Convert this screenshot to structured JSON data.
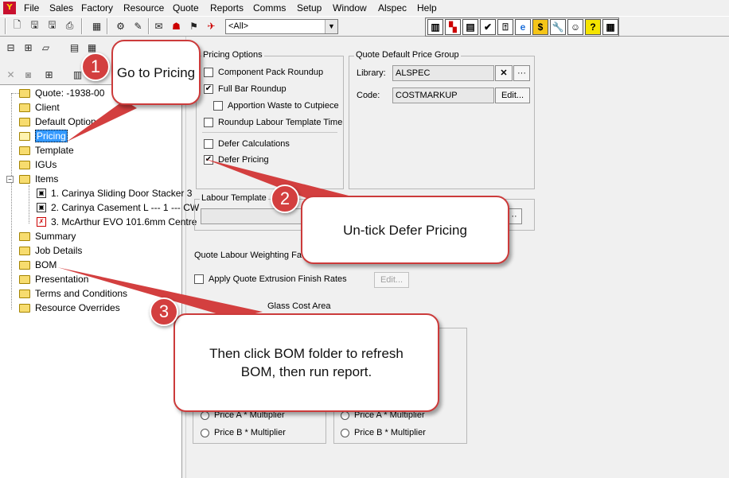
{
  "menu": [
    "File",
    "Sales",
    "Factory",
    "Resource",
    "Quote",
    "Reports",
    "Comms",
    "Setup",
    "Window",
    "Alspec",
    "Help"
  ],
  "app_icon": "Y",
  "toolbar": {
    "filter_value": "<All>"
  },
  "tree": {
    "root": "Quote: -1938-00",
    "items": [
      "Client",
      "Default Options",
      "Pricing",
      "Template",
      "IGUs",
      "Items"
    ],
    "children": [
      "1. Carinya Sliding Door Stacker 3",
      "2. Carinya Casement L --- 1 --- CW",
      "3. McArthur EVO 101.6mm Centre"
    ],
    "after": [
      "Summary",
      "Job Details",
      "BOM",
      "Presentation",
      "Terms and Conditions",
      "Resource Overrides"
    ]
  },
  "pricing": {
    "group_title": "Pricing Options",
    "options": [
      {
        "label": "Component Pack Roundup",
        "checked": ""
      },
      {
        "label": "Full Bar Roundup",
        "checked": "✔"
      },
      {
        "label": "Apportion Waste to Cutpiece",
        "checked": ""
      },
      {
        "label": "Roundup Labour Template Time",
        "checked": ""
      },
      {
        "label": "Defer Calculations",
        "checked": ""
      },
      {
        "label": "Defer Pricing",
        "checked": "✔"
      }
    ]
  },
  "price_group": {
    "title": "Quote Default Price Group",
    "library_label": "Library:",
    "library_value": "ALSPEC",
    "code_label": "Code:",
    "code_value": "COSTMARKUP",
    "clear": "✕",
    "browse": "···",
    "edit": "Edit..."
  },
  "labour": {
    "title": "Labour Template",
    "browse": "··"
  },
  "weighting": {
    "label": "Quote Labour Weighting Fac"
  },
  "extrusion": {
    "label": "Apply Quote Extrusion Finish Rates",
    "edit": "Edit..."
  },
  "glass": {
    "label": "Glass Cost Area"
  },
  "price_radios": {
    "a": "Price A * Multiplier",
    "b": "Price B * Multiplier"
  },
  "callouts": [
    {
      "num": "1",
      "text": "Go to Pricing"
    },
    {
      "num": "2",
      "text": "Un-tick Defer Pricing"
    },
    {
      "num": "3",
      "text": "Then click BOM folder to refresh BOM, then run report."
    }
  ],
  "colors": {
    "accent": "#cc3b3b",
    "selection": "#3399ff"
  }
}
